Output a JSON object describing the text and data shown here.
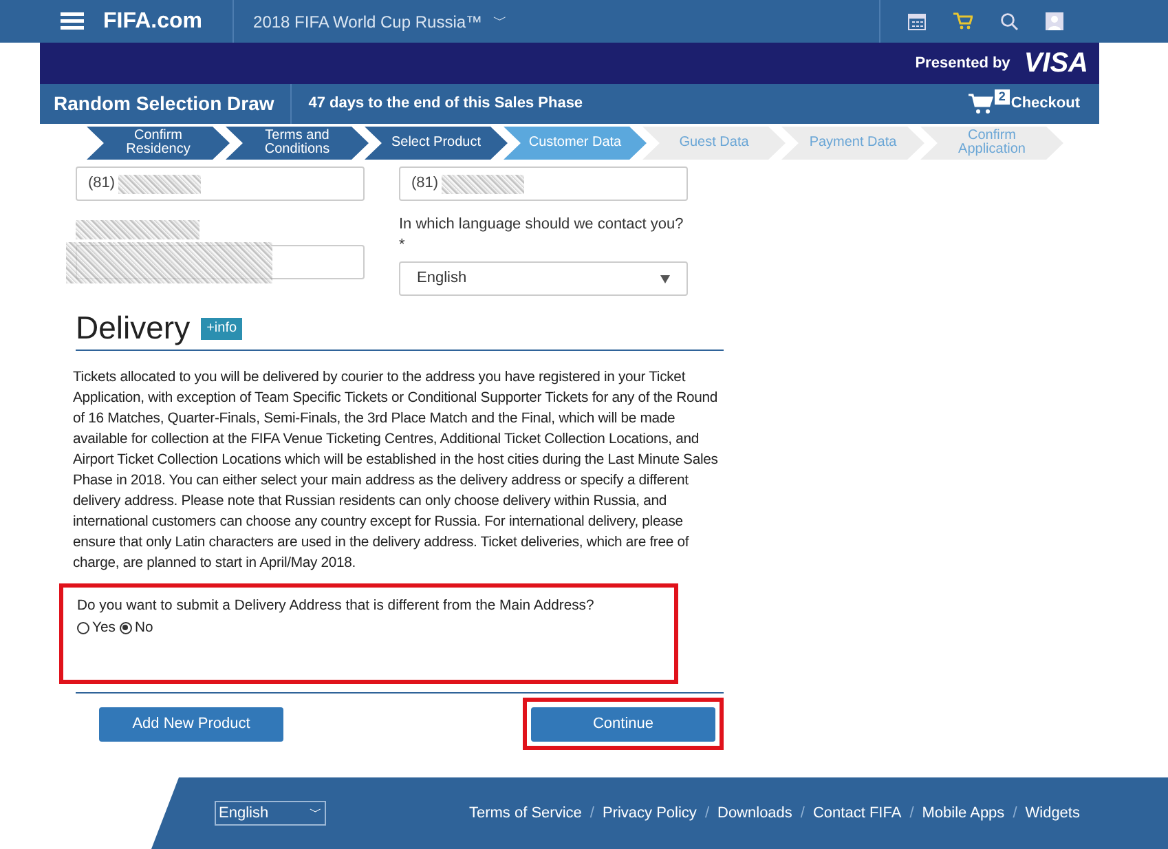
{
  "top_bar": {
    "logo": "FIFA.com",
    "site_title": "2018 FIFA World Cup Russia™",
    "dropdown_glyph": "﹀"
  },
  "sponsor": {
    "label": "Presented by",
    "brand": "VISA"
  },
  "title_bar": {
    "title": "Random Selection Draw",
    "countdown": "47 days to the end of this Sales Phase",
    "cart_count": "2",
    "checkout": "Checkout"
  },
  "steps": [
    {
      "label": "Confirm Residency",
      "completed": true,
      "selected": false
    },
    {
      "label": "Terms and Conditions",
      "completed": true,
      "selected": false
    },
    {
      "label": "Select Product",
      "completed": true,
      "selected": false
    },
    {
      "label": "Customer Data",
      "completed": false,
      "selected": true
    },
    {
      "label": "Guest Data",
      "completed": false,
      "selected": false
    },
    {
      "label": "Payment Data",
      "completed": false,
      "selected": false
    },
    {
      "label": "Confirm Application",
      "completed": false,
      "selected": false
    }
  ],
  "form": {
    "phone_1": "(81)",
    "phone_2": "(81)",
    "language_label": "In which language should we contact you? *",
    "language_value": "English"
  },
  "delivery": {
    "heading": "Delivery",
    "info_badge": "+info",
    "text": "Tickets allocated to you will be delivered by courier to the address you have registered in your Ticket Application, with exception of Team Specific Tickets or Conditional Supporter Tickets for any of the Round of 16 Matches, Quarter-Finals, Semi-Finals, the 3rd Place Match and the Final, which will be made available for collection at the FIFA Venue Ticketing Centres, Additional Ticket Collection Locations, and Airport Ticket Collection Locations which will be established in the host cities during the Last Minute Sales Phase in 2018. You can either select your main address as the delivery address or specify a different delivery address. Please note that Russian residents can only choose delivery within Russia, and international customers can choose any country except for Russia. For international delivery, please ensure that only Latin characters are used in the delivery address. Ticket deliveries, which are free of charge, are planned to start in April/May 2018.",
    "question": "Do you want to submit a Delivery Address that is different from the Main Address?",
    "highlighted": true,
    "options": [
      {
        "label": "Yes",
        "selected": false
      },
      {
        "label": "No",
        "selected": true
      }
    ]
  },
  "buttons": [
    {
      "label": "Add New Product",
      "highlighted": false
    },
    {
      "label": "Continue",
      "highlighted": true
    }
  ],
  "footer": {
    "language": "English",
    "links": [
      {
        "label": "Terms of Service"
      },
      {
        "separator": "/",
        "label": "Privacy Policy"
      },
      {
        "separator": "/",
        "label": "Downloads"
      },
      {
        "separator": "/",
        "label": "Contact FIFA"
      },
      {
        "separator": "/",
        "label": "Mobile Apps"
      },
      {
        "separator": "/",
        "label": "Widgets"
      }
    ]
  }
}
